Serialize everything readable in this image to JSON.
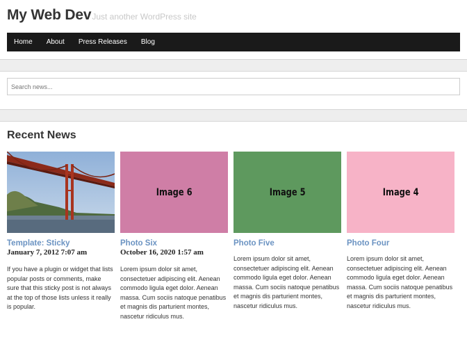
{
  "site": {
    "title": "My Web Dev",
    "tagline": "Just another WordPress site"
  },
  "nav": {
    "items": [
      "Home",
      "About",
      "Press Releases",
      "Blog"
    ]
  },
  "search": {
    "placeholder": "Search news..."
  },
  "section": {
    "title": "Recent News"
  },
  "posts": [
    {
      "title": "Template: Sticky",
      "date": "January 7, 2012 7:07 am",
      "excerpt": "If you have a plugin or widget that lists popular posts or comments, make sure that this sticky post is not always at the top of those lists unless it really is popular.",
      "image_label": "",
      "image": "golden-gate-bridge-photo"
    },
    {
      "title": "Photo Six",
      "date": "October 16, 2020 1:57 am",
      "excerpt": "Lorem ipsum dolor sit amet, consectetuer adipiscing elit. Aenean commodo ligula eget dolor. Aenean massa. Cum sociis natoque penatibus et magnis dis parturient montes, nascetur ridiculus mus.",
      "image_label": "Image 6",
      "image_color": "#cf7ea6"
    },
    {
      "title": "Photo Five",
      "date": "",
      "excerpt": "Lorem ipsum dolor sit amet, consectetuer adipiscing elit. Aenean commodo ligula eget dolor. Aenean massa. Cum sociis natoque penatibus et magnis dis parturient montes, nascetur ridiculus mus.",
      "image_label": "Image 5",
      "image_color": "#5e995e"
    },
    {
      "title": "Photo Four",
      "date": "",
      "excerpt": "Lorem ipsum dolor sit amet, consectetuer adipiscing elit. Aenean commodo ligula eget dolor. Aenean massa. Cum sociis natoque penatibus et magnis dis parturient montes, nascetur ridiculus mus.",
      "image_label": "Image 4",
      "image_color": "#f7b3c7"
    }
  ]
}
